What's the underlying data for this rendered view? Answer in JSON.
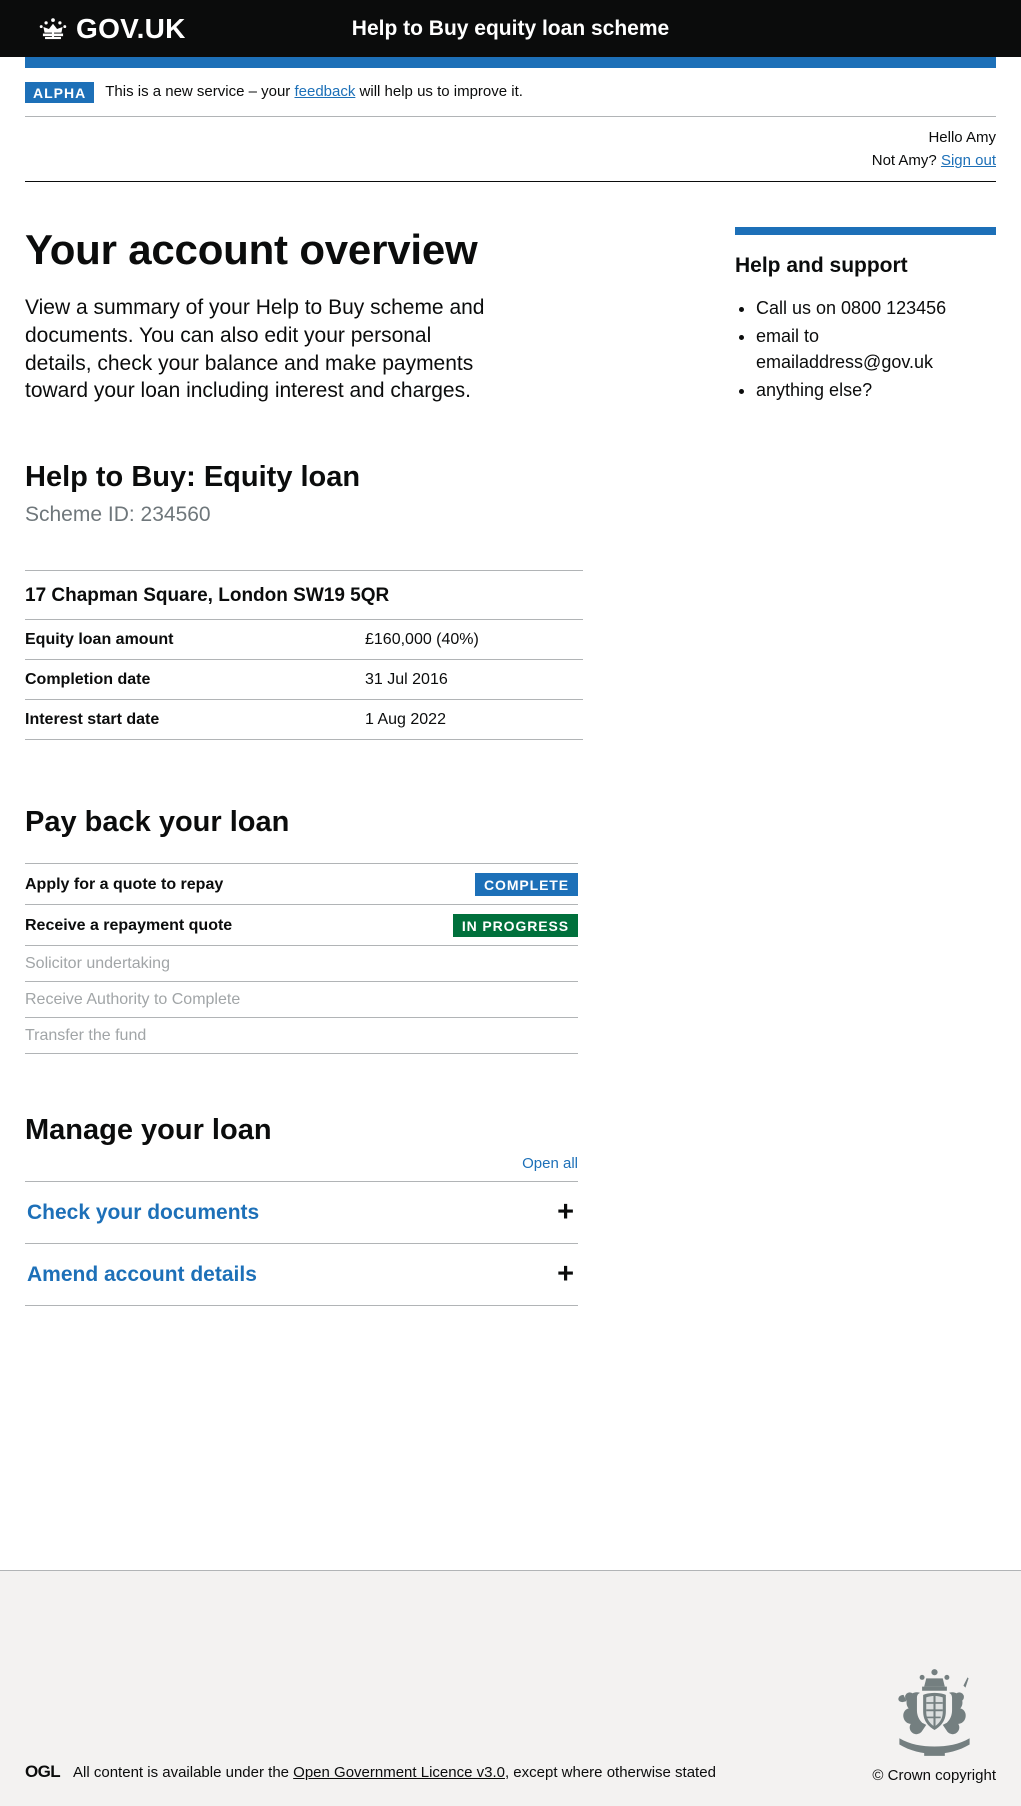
{
  "header": {
    "logo_text": "GOV.UK",
    "logo_icon": "crown-icon",
    "service_name": "Help to Buy equity loan scheme"
  },
  "phase_banner": {
    "tag": "ALPHA",
    "text_before": "This is a new service – your ",
    "link": "feedback",
    "text_after": " will help us to improve it."
  },
  "account_bar": {
    "greeting": "Hello Amy",
    "not_you": "Not Amy? ",
    "sign_out": "Sign out"
  },
  "main": {
    "page_title": "Your account overview",
    "intro": "View a summary of your Help to Buy scheme and documents. You can also edit your personal details, check your balance and make payments toward your loan including interest and charges."
  },
  "aside": {
    "heading": "Help and support",
    "items": [
      "Call us on 0800 123456",
      "email to emailaddress@gov.uk",
      "anything else?"
    ]
  },
  "scheme": {
    "heading": "Help to Buy: Equity loan",
    "scheme_id": "Scheme ID: 234560",
    "address": "17 Chapman Square, London SW19 5QR",
    "rows": [
      {
        "key": "Equity loan amount",
        "value": "£160,000 (40%)"
      },
      {
        "key": "Completion date",
        "value": "31 Jul 2016"
      },
      {
        "key": "Interest start date",
        "value": "1 Aug 2022"
      }
    ]
  },
  "payback": {
    "heading": "Pay back your loan",
    "tasks": [
      {
        "name": "Apply for a quote to repay",
        "status": "COMPLETE",
        "state": "complete"
      },
      {
        "name": "Receive a repayment quote",
        "status": "IN PROGRESS",
        "state": "inprogress"
      },
      {
        "name": "Solicitor undertaking",
        "status": "",
        "state": "disabled"
      },
      {
        "name": "Receive Authority to Complete",
        "status": "",
        "state": "disabled"
      },
      {
        "name": "Transfer the fund",
        "status": "",
        "state": "disabled"
      }
    ]
  },
  "manage": {
    "heading": "Manage your loan",
    "open_all": "Open all",
    "sections": [
      {
        "title": "Check your documents",
        "toggle": "+"
      },
      {
        "title": "Amend account details",
        "toggle": "+"
      }
    ]
  },
  "footer": {
    "licence_before": "All content is available under the ",
    "licence_link": "Open Government Licence v3.0",
    "licence_after": ", except where otherwise stated",
    "ogl": "OGL",
    "crown_copyright": "© Crown copyright"
  },
  "colors": {
    "blue": "#1d70b8",
    "green": "#00703c",
    "black": "#0b0c0c",
    "grey_border": "#b1b4b6",
    "footer_bg": "#f3f2f1",
    "muted_text": "#6f777b"
  }
}
